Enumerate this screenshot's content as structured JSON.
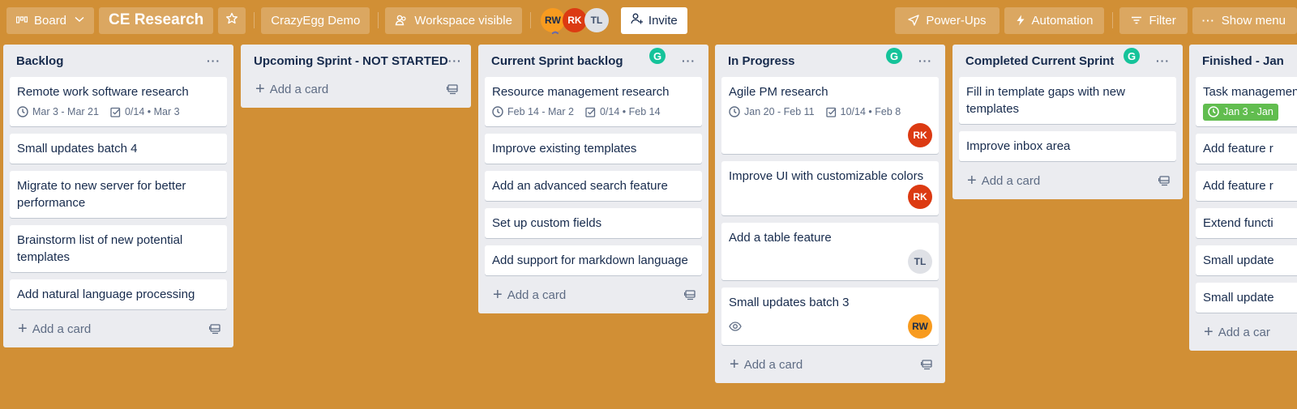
{
  "header": {
    "view_switcher": "Board",
    "board_title": "CE Research",
    "workspace": "CrazyEgg Demo",
    "visibility": "Workspace visible",
    "members": [
      "RW",
      "RK",
      "TL"
    ],
    "invite": "Invite",
    "power_ups": "Power-Ups",
    "automation": "Automation",
    "filter": "Filter",
    "show_menu": "Show menu"
  },
  "lists": [
    {
      "title": "Backlog",
      "cards": [
        {
          "title": "Remote work software research",
          "dates": "Mar 3 - Mar 21",
          "checklist": "0/14 • Mar 3"
        },
        {
          "title": "Small updates batch 4"
        },
        {
          "title": "Migrate to new server for better performance"
        },
        {
          "title": "Brainstorm list of new potential templates"
        },
        {
          "title": "Add natural language processing"
        }
      ],
      "add_card": "Add a card"
    },
    {
      "title": "Upcoming Sprint - NOT STARTED",
      "cards": [],
      "add_card": "Add a card"
    },
    {
      "title": "Current Sprint backlog",
      "cards": [
        {
          "title": "Resource management research",
          "dates": "Feb 14 - Mar 2",
          "checklist": "0/14 • Feb 14"
        },
        {
          "title": "Improve existing templates"
        },
        {
          "title": "Add an advanced search feature"
        },
        {
          "title": "Set up custom fields"
        },
        {
          "title": "Add support for markdown language"
        }
      ],
      "add_card": "Add a card"
    },
    {
      "title": "In Progress",
      "cards": [
        {
          "title": "Agile PM research",
          "dates": "Jan 20 - Feb 11",
          "checklist": "10/14 • Feb 8",
          "member": "RK"
        },
        {
          "title": "Improve UI with customizable colors",
          "member": "RK"
        },
        {
          "title": "Add a table feature",
          "member": "TL"
        },
        {
          "title": "Small updates batch 3",
          "member": "RW",
          "watching": true
        }
      ],
      "add_card": "Add a card"
    },
    {
      "title": "Completed Current Sprint",
      "cards": [
        {
          "title": "Fill in template gaps with new templates"
        },
        {
          "title": "Improve inbox area"
        }
      ],
      "add_card": "Add a card"
    },
    {
      "title": "Finished - Jan",
      "cards": [
        {
          "title": "Task management",
          "dates": "Jan 3 - Jan"
        },
        {
          "title": "Add feature r"
        },
        {
          "title": "Add feature r"
        },
        {
          "title": "Extend functi"
        },
        {
          "title": "Small update"
        },
        {
          "title": "Small update"
        }
      ],
      "add_card": "Add a car"
    }
  ],
  "colors": {
    "board_bg": "#d18f35",
    "list_bg": "#ebecf0",
    "member_rw": "#f89b1f",
    "member_rk": "#dc3a12",
    "member_tl": "#dfe1e6",
    "grammarly": "#15c39a",
    "due_complete": "#61bd4f"
  }
}
